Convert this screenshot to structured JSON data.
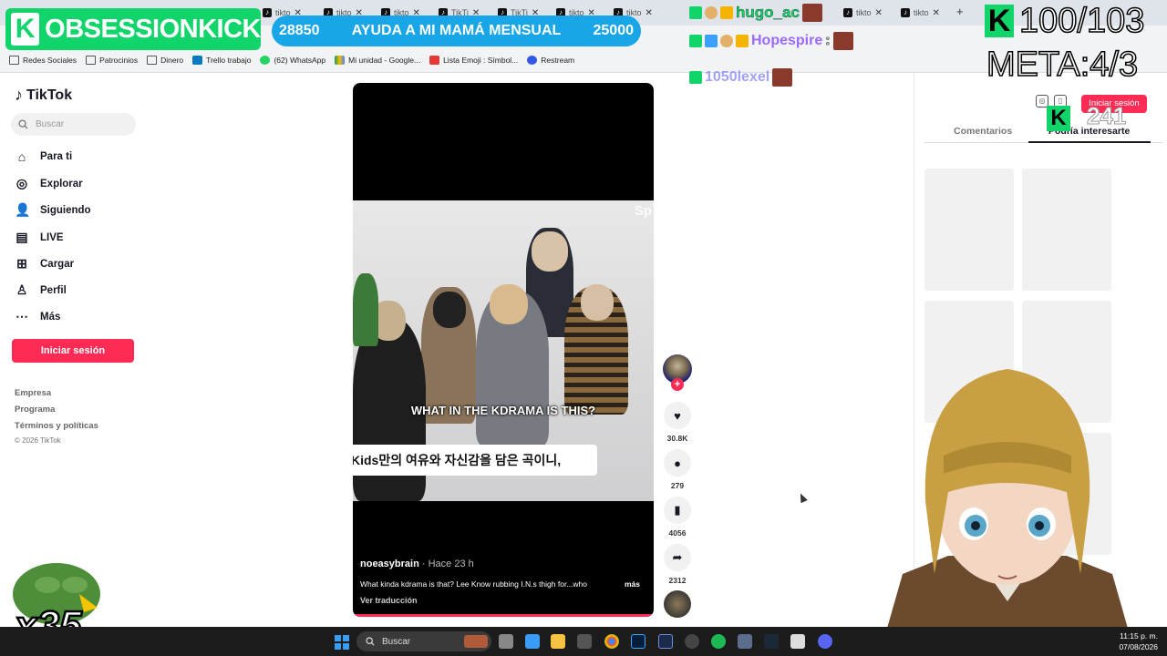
{
  "browser": {
    "tabs": [
      "tikto",
      "tikto",
      "tikto",
      "TikTi",
      "TikTi",
      "tikto",
      "tikto",
      "tikto",
      "tikto"
    ],
    "bookmarks": [
      "Redes Sociales",
      "Patrocinios",
      "Dinero",
      "Trello trabajo",
      "(62) WhatsApp",
      "Mi unidad - Google...",
      "Lista Emoji : Símbol...",
      "Restream"
    ]
  },
  "overlay": {
    "brand": "OBSESSIONKICK",
    "goal_left": "28850",
    "goal_text": "AYUDA A MI MAMÁ MENSUAL",
    "goal_right": "25000",
    "chat": [
      {
        "user": "hugo_ac",
        "suffix": "",
        "color": "#11d46a"
      },
      {
        "user": "Hopespire",
        "suffix": ":",
        "color": "#9b6bff"
      },
      {
        "user": "1050lexel",
        "suffix": "",
        "color": "#7a7aff"
      }
    ],
    "counter": "100/103",
    "meta": "META:4/3",
    "sub_count": "241",
    "multiplier": "x35"
  },
  "tiktok": {
    "logo": "TikTok",
    "search_placeholder": "Buscar",
    "nav": [
      {
        "label": "Para ti",
        "icon": "home-icon"
      },
      {
        "label": "Explorar",
        "icon": "compass-icon"
      },
      {
        "label": "Siguiendo",
        "icon": "following-icon"
      },
      {
        "label": "LIVE",
        "icon": "live-icon"
      },
      {
        "label": "Cargar",
        "icon": "upload-icon"
      },
      {
        "label": "Perfil",
        "icon": "profile-icon"
      },
      {
        "label": "Más",
        "icon": "more-icon"
      }
    ],
    "login_button": "Iniciar sesión",
    "footer": [
      "Empresa",
      "Programa",
      "Términos y políticas"
    ],
    "copyright": "© 2026 TikTok",
    "video": {
      "watermark": "Sp",
      "subtitle_en": "WHAT IN THE KDRAMA IS THIS?",
      "subtitle_kr": "Kids만의 여유와 자신감을 담은 곡이니,",
      "author": "noeasybrain",
      "time": "· Hace 23 h",
      "description": "What kinda kdrama is that? Lee Know rubbing I.N.s thigh for...who",
      "more": "más",
      "translate": "Ver traducción"
    },
    "actions": {
      "likes": "30.8K",
      "comments": "279",
      "saves": "4056",
      "shares": "2312"
    },
    "right_panel": {
      "login": "Iniciar sesión",
      "tab_comments": "Comentarios",
      "tab_interest": "Podría interesarte"
    }
  },
  "taskbar": {
    "search": "Buscar",
    "time": "11:15 p. m.",
    "date": "07/08/2026"
  }
}
